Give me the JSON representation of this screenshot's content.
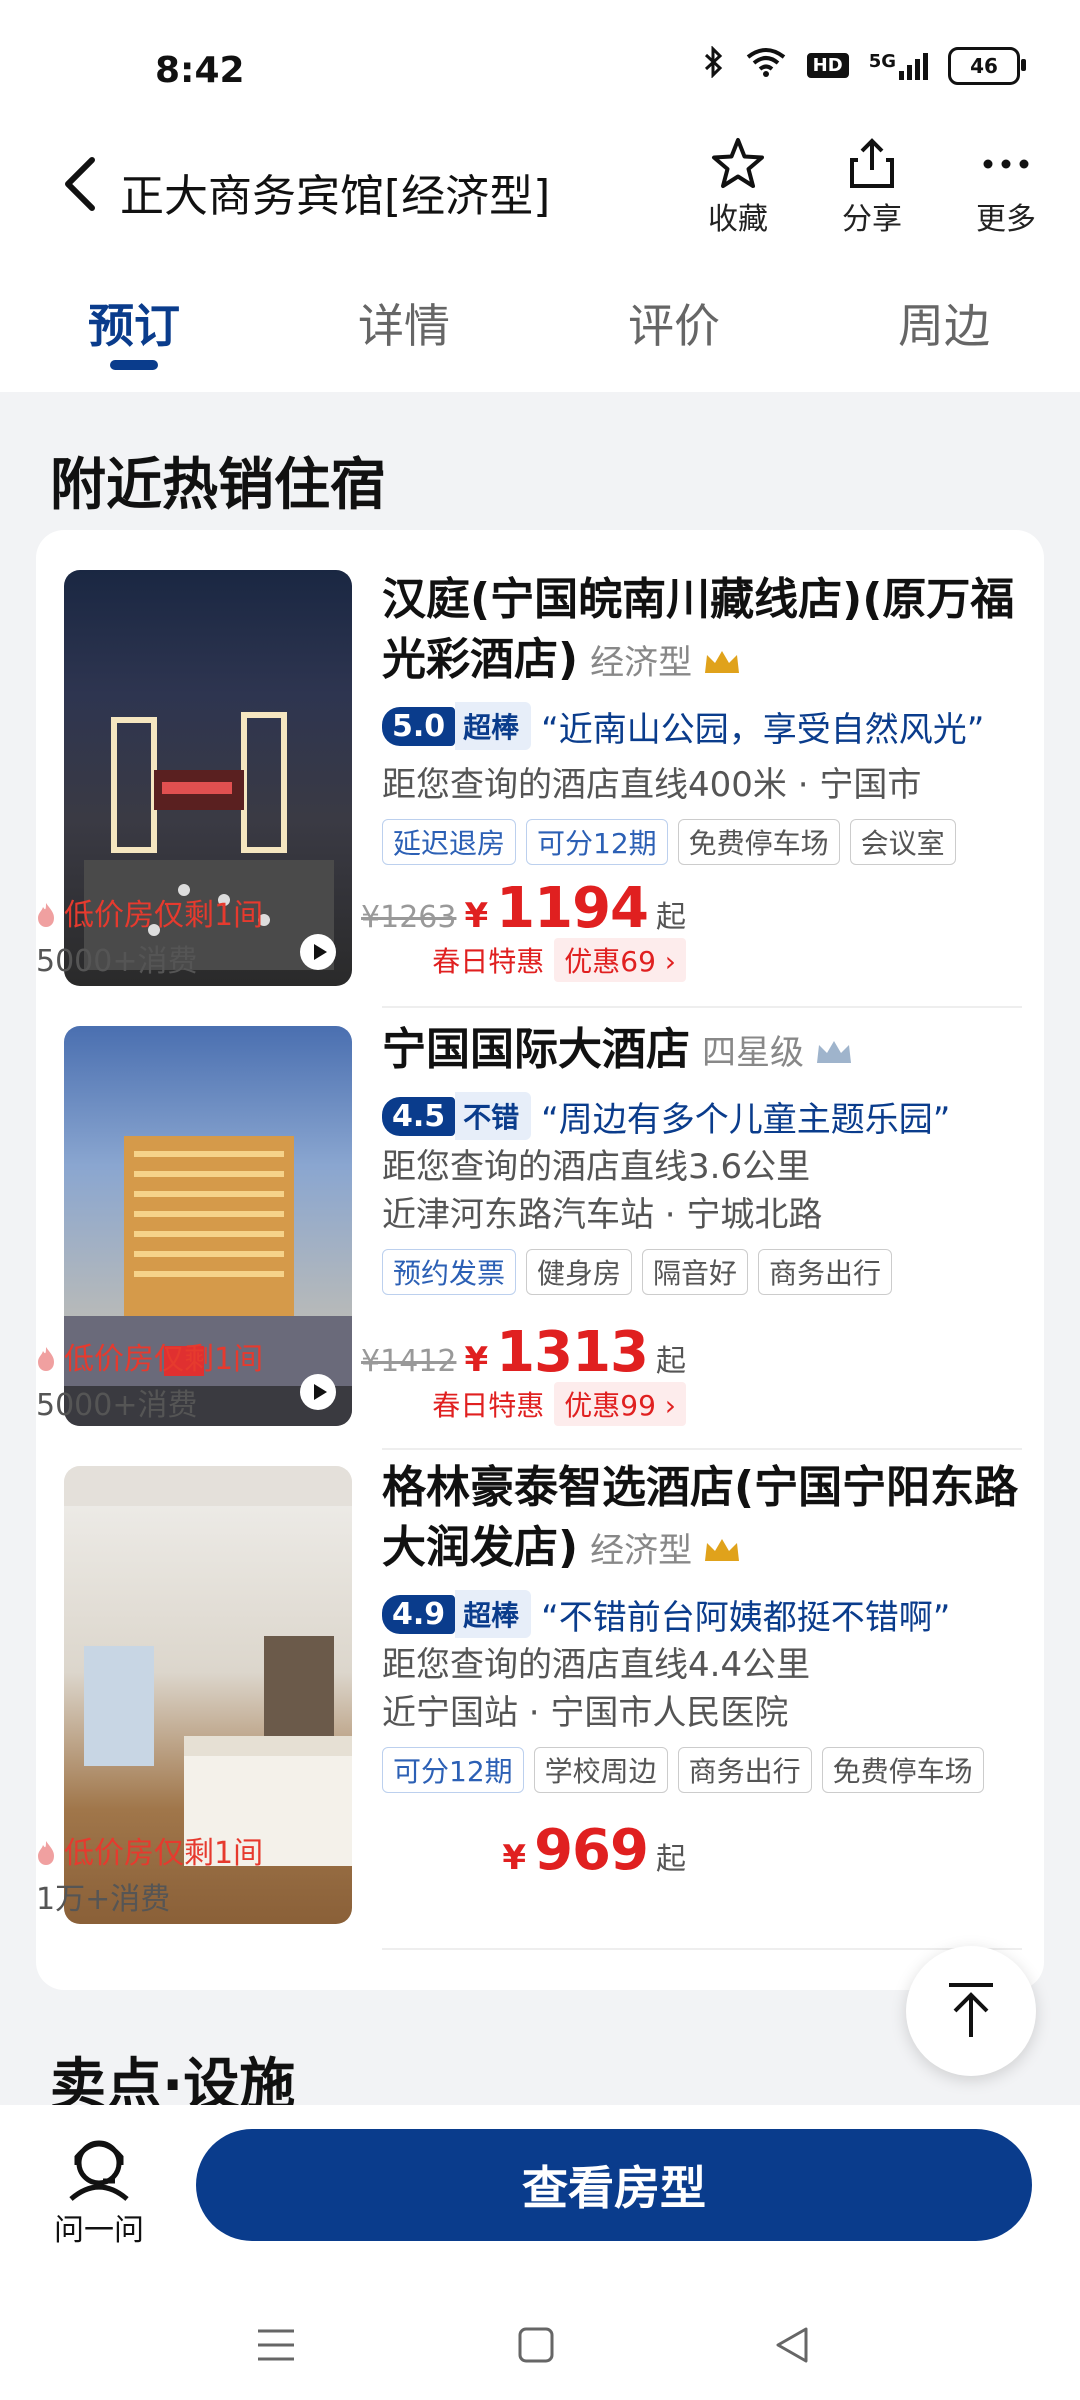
{
  "status_bar": {
    "time": "8:42",
    "network": "5G",
    "hd_label": "HD",
    "battery": "46",
    "icons": [
      "bluetooth-icon",
      "wifi-icon",
      "hd-icon",
      "signal-icon",
      "battery-icon"
    ]
  },
  "header": {
    "title": "正大商务宾馆[经济型]",
    "actions": [
      {
        "label": "收藏",
        "icon": "star-icon"
      },
      {
        "label": "分享",
        "icon": "share-icon"
      },
      {
        "label": "更多",
        "icon": "more-icon"
      }
    ]
  },
  "tabs": [
    {
      "label": "预订",
      "active": true
    },
    {
      "label": "详情",
      "active": false
    },
    {
      "label": "评价",
      "active": false
    },
    {
      "label": "周边",
      "active": false
    }
  ],
  "section_title": "附近热销住宿",
  "hotels": [
    {
      "name": "汉庭(宁国皖南川藏线店)(原万福光彩酒店)",
      "category": "经济型",
      "crown_color": "#e0a21b",
      "score": "5.0",
      "score_label": "超棒",
      "quote": "“近南山公园，享受自然风光”",
      "distance": "距您查询的酒店直线400米 · 宁国市",
      "location": "",
      "tags": [
        {
          "t": "延迟退房",
          "blue": true
        },
        {
          "t": "可分12期",
          "blue": true
        },
        {
          "t": "免费停车场",
          "blue": false
        },
        {
          "t": "会议室",
          "blue": false
        }
      ],
      "hot": "低价房仅剩1间",
      "sold": "5000+消费",
      "orig_price": "¥1263",
      "currency": "¥",
      "price": "1194",
      "price_suffix": "起",
      "promo_a": "春日特惠",
      "promo_b": "优惠69 ›",
      "has_video": true
    },
    {
      "name": "宁国国际大酒店",
      "category": "四星级",
      "crown_color": "#9fb4cc",
      "score": "4.5",
      "score_label": "不错",
      "quote": "“周边有多个儿童主题乐园”",
      "distance": "距您查询的酒店直线3.6公里",
      "location": "近津河东路汽车站 · 宁城北路",
      "tags": [
        {
          "t": "预约发票",
          "blue": true
        },
        {
          "t": "健身房",
          "blue": false
        },
        {
          "t": "隔音好",
          "blue": false
        },
        {
          "t": "商务出行",
          "blue": false
        }
      ],
      "hot": "低价房仅剩1间",
      "sold": "5000+消费",
      "orig_price": "¥1412",
      "currency": "¥",
      "price": "1313",
      "price_suffix": "起",
      "promo_a": "春日特惠",
      "promo_b": "优惠99 ›",
      "has_video": true
    },
    {
      "name": "格林豪泰智选酒店(宁国宁阳东路大润发店)",
      "category": "经济型",
      "crown_color": "#e0a21b",
      "score": "4.9",
      "score_label": "超棒",
      "quote": "“不错前台阿姨都挺不错啊”",
      "distance": "距您查询的酒店直线4.4公里",
      "location": "近宁国站 · 宁国市人民医院",
      "tags": [
        {
          "t": "可分12期",
          "blue": true
        },
        {
          "t": "学校周边",
          "blue": false
        },
        {
          "t": "商务出行",
          "blue": false
        },
        {
          "t": "免费停车场",
          "blue": false
        }
      ],
      "hot": "低价房仅剩1间",
      "sold": "1万+消费",
      "orig_price": "",
      "currency": "¥",
      "price": "969",
      "price_suffix": "起",
      "promo_a": "",
      "promo_b": "",
      "has_video": false
    }
  ],
  "next_section_title": "卖点·设施",
  "bottom": {
    "ask_label": "问一问",
    "cta_label": "查看房型"
  },
  "colors": {
    "brand": "#0a3c8c",
    "price": "#e02020"
  }
}
